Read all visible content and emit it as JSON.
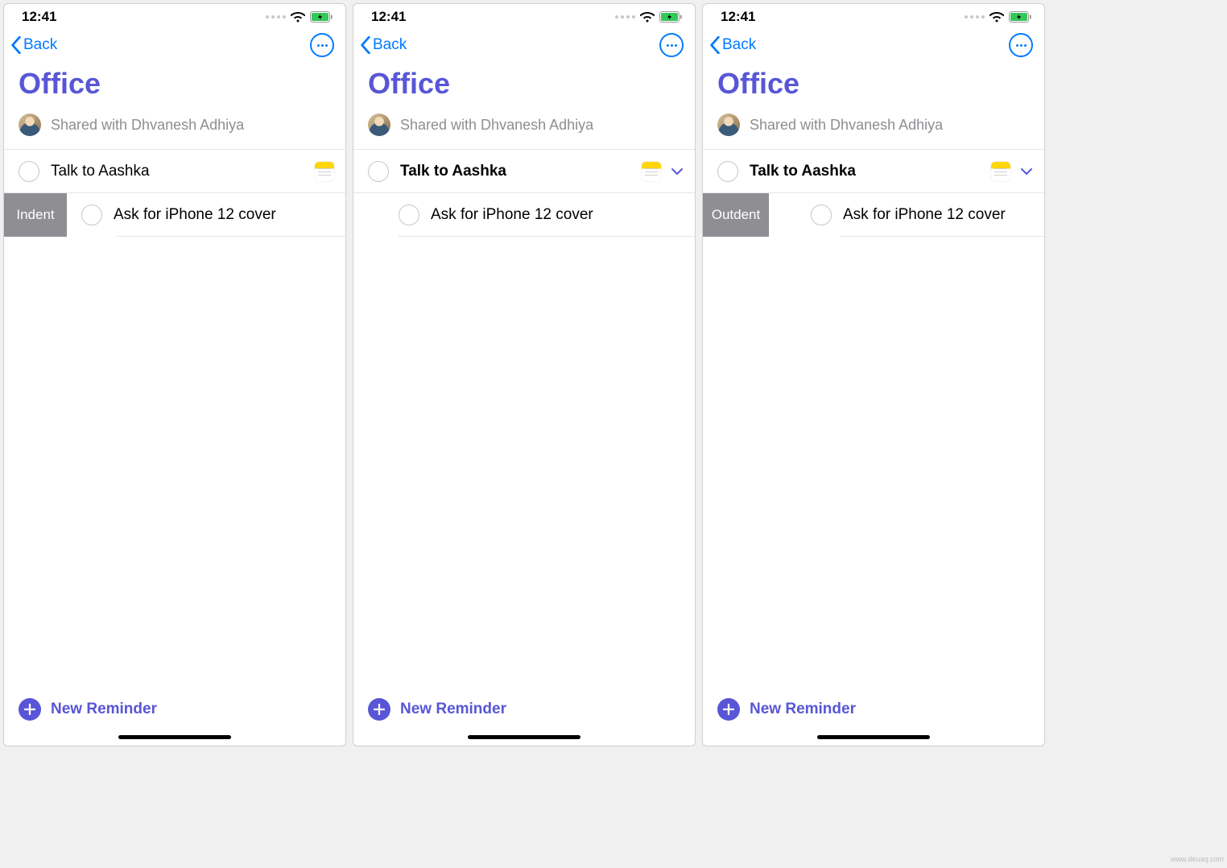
{
  "status": {
    "time": "12:41"
  },
  "nav": {
    "back": "Back"
  },
  "list": {
    "title": "Office",
    "sharedWith": "Shared with Dhvanesh Adhiya"
  },
  "reminders": {
    "parent": "Talk to Aashka",
    "child": "Ask for iPhone 12 cover"
  },
  "actions": {
    "indent": "Indent",
    "outdent": "Outdent",
    "newReminder": "New Reminder"
  },
  "watermark": "www.deuaq.com"
}
